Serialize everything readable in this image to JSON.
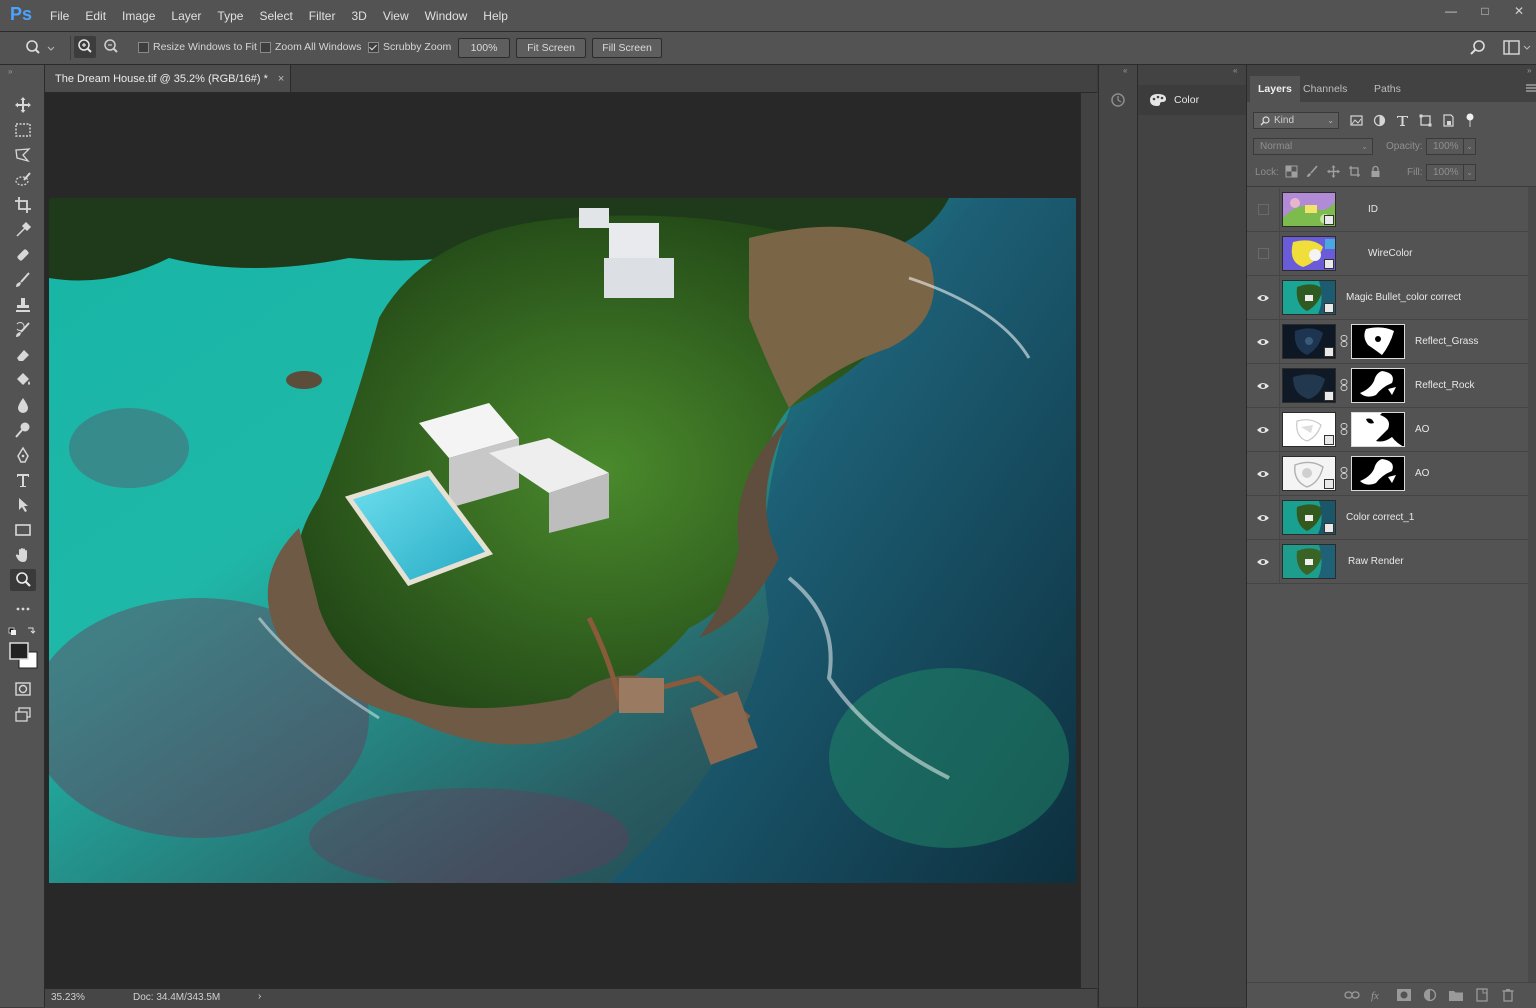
{
  "app": {
    "logo": "Ps"
  },
  "menu": [
    "File",
    "Edit",
    "Image",
    "Layer",
    "Type",
    "Select",
    "Filter",
    "3D",
    "View",
    "Window",
    "Help"
  ],
  "window_controls": {
    "minimize": "—",
    "maximize": "□",
    "close": "✕"
  },
  "options": {
    "resize_windows": "Resize Windows to Fit",
    "zoom_all": "Zoom All Windows",
    "scrubby_zoom": "Scrubby Zoom",
    "zoom_value": "100%",
    "fit_screen": "Fit Screen",
    "fill_screen": "Fill Screen",
    "resize_checked": false,
    "zoom_all_checked": false,
    "scrubby_checked": true
  },
  "document": {
    "tab_title": "The Dream House.tif @ 35.2% (RGB/16#) *",
    "close_glyph": "×",
    "zoom_status": "35.23%",
    "doc_size": "Doc: 34.4M/343.5M",
    "status_arrow": "›"
  },
  "color_panel": {
    "label": "Color"
  },
  "layers_panel": {
    "tabs": [
      "Layers",
      "Channels",
      "Paths"
    ],
    "filter_kind": "Kind",
    "blend_mode": "Normal",
    "opacity_label": "Opacity:",
    "opacity_value": "100%",
    "lock_label": "Lock:",
    "fill_label": "Fill:",
    "fill_value": "100%",
    "layers": [
      {
        "name": "ID",
        "visible": false,
        "mask": false
      },
      {
        "name": "WireColor",
        "visible": false,
        "mask": false
      },
      {
        "name": "Magic Bullet_color correct",
        "visible": true,
        "mask": false
      },
      {
        "name": "Reflect_Grass",
        "visible": true,
        "mask": true
      },
      {
        "name": "Reflect_Rock",
        "visible": true,
        "mask": true
      },
      {
        "name": "AO",
        "visible": true,
        "mask": true
      },
      {
        "name": "AO",
        "visible": true,
        "mask": true
      },
      {
        "name": "Color correct_1",
        "visible": true,
        "mask": false
      },
      {
        "name": "Raw Render",
        "visible": true,
        "mask": false
      }
    ]
  },
  "colors": {
    "accent": "#4ba3ff",
    "panel": "#535353",
    "canvas_bg": "#282828"
  }
}
